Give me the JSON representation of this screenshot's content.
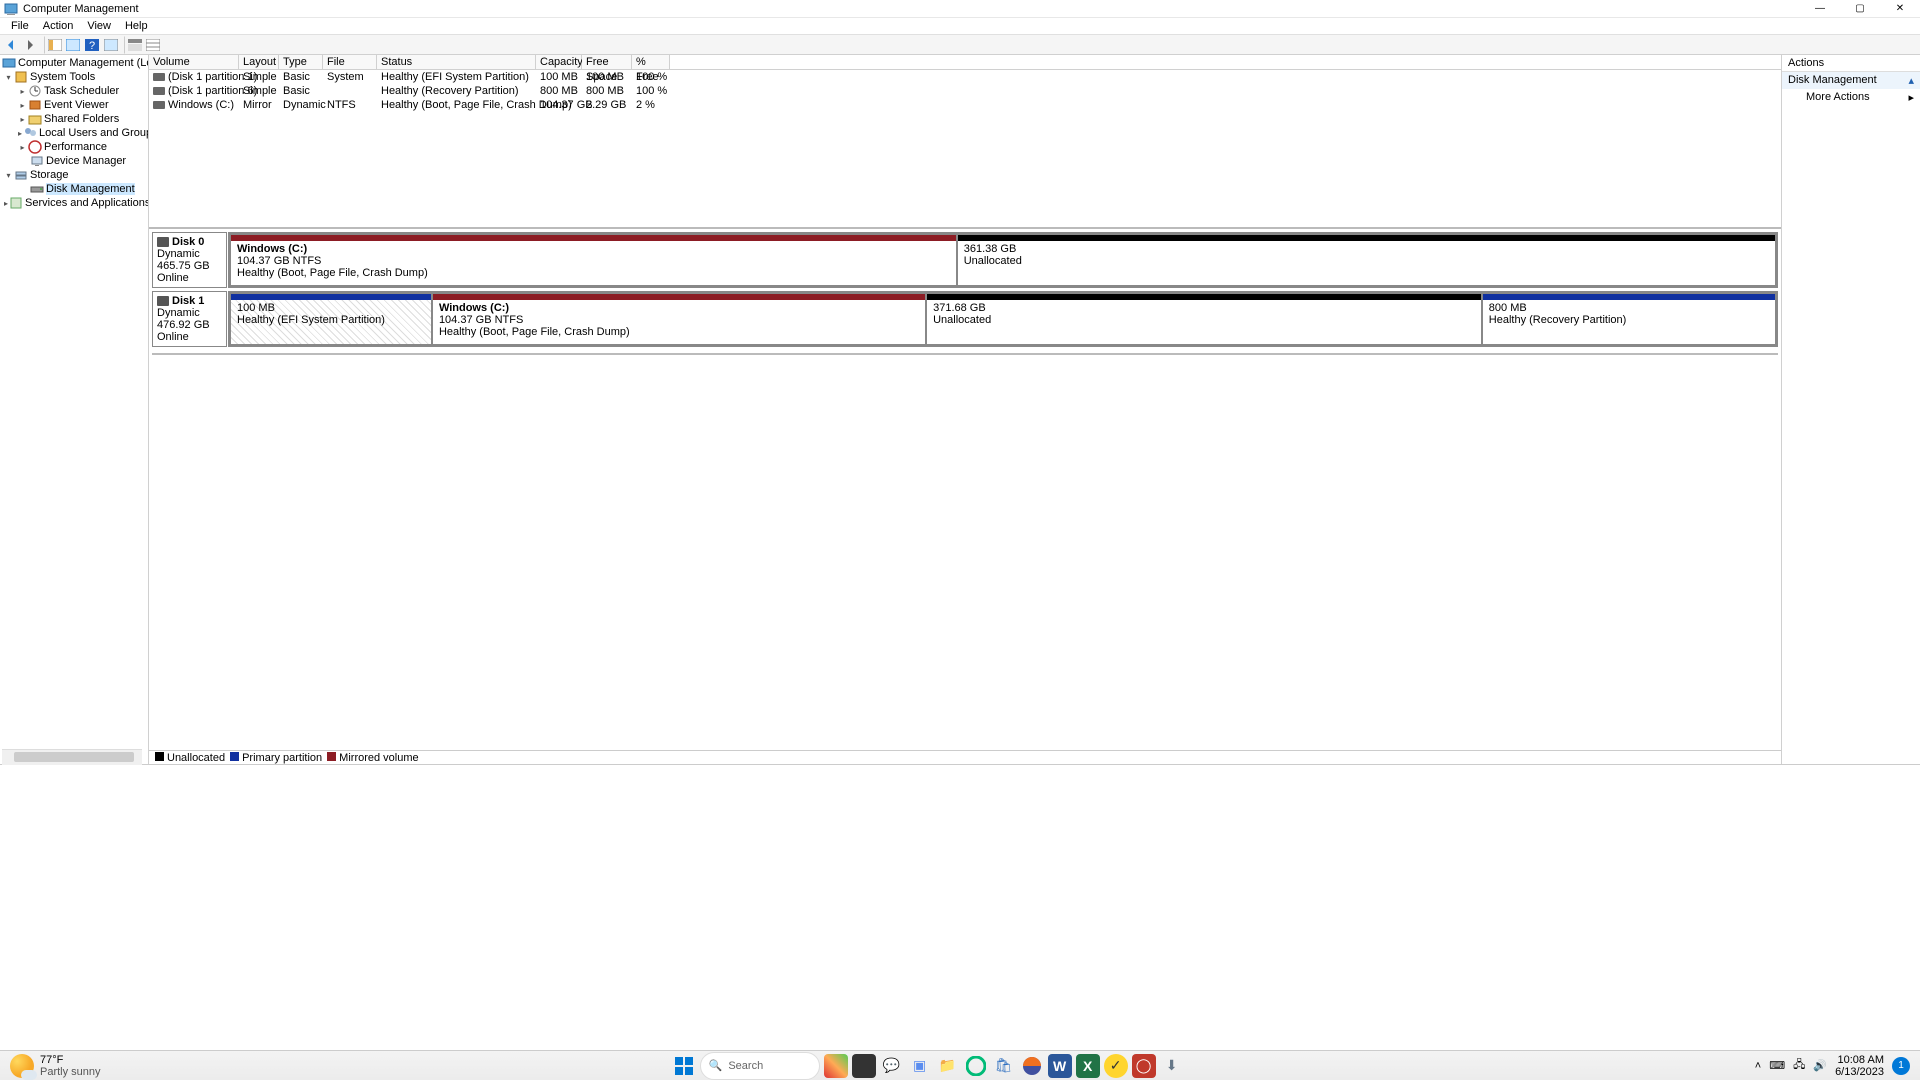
{
  "window": {
    "title": "Computer Management"
  },
  "menu": [
    "File",
    "Action",
    "View",
    "Help"
  ],
  "tree": {
    "root": "Computer Management (Local",
    "system": "System Tools",
    "ts": "Task Scheduler",
    "ev": "Event Viewer",
    "sf": "Shared Folders",
    "lug": "Local Users and Groups",
    "perf": "Performance",
    "dm": "Device Manager",
    "storage": "Storage",
    "disk": "Disk Management",
    "sa": "Services and Applications"
  },
  "cols": [
    "Volume",
    "Layout",
    "Type",
    "File System",
    "Status",
    "Capacity",
    "Free Space",
    "% Free"
  ],
  "vols": [
    {
      "v": "(Disk 1 partition 1)",
      "l": "Simple",
      "t": "Basic",
      "fs": "",
      "s": "Healthy (EFI System Partition)",
      "c": "100 MB",
      "f": "100 MB",
      "p": "100 %"
    },
    {
      "v": "(Disk 1 partition 6)",
      "l": "Simple",
      "t": "Basic",
      "fs": "",
      "s": "Healthy (Recovery Partition)",
      "c": "800 MB",
      "f": "800 MB",
      "p": "100 %"
    },
    {
      "v": "Windows (C:)",
      "l": "Mirror",
      "t": "Dynamic",
      "fs": "NTFS",
      "s": "Healthy (Boot, Page File, Crash Dump)",
      "c": "104.37 GB",
      "f": "2.29 GB",
      "p": "2 %"
    }
  ],
  "disks": [
    {
      "name": "Disk 0",
      "type": "Dynamic",
      "size": "465.75 GB",
      "status": "Online",
      "parts": [
        {
          "title": "Windows  (C:)",
          "line2": "104.37 GB NTFS",
          "line3": "Healthy (Boot, Page File, Crash Dump)",
          "color": "#8c1c24",
          "flex": 47,
          "hatch": false
        },
        {
          "title": "",
          "line2": "361.38 GB",
          "line3": "Unallocated",
          "color": "#000",
          "flex": 53,
          "hatch": false
        }
      ]
    },
    {
      "name": "Disk 1",
      "type": "Dynamic",
      "size": "476.92 GB",
      "status": "Online",
      "parts": [
        {
          "title": "",
          "line2": "100 MB",
          "line3": "Healthy (EFI System Partition)",
          "color": "#1030a0",
          "flex": 13,
          "hatch": true
        },
        {
          "title": "Windows  (C:)",
          "line2": "104.37 GB NTFS",
          "line3": "Healthy (Boot, Page File, Crash Dump)",
          "color": "#8c1c24",
          "flex": 32,
          "hatch": false
        },
        {
          "title": "",
          "line2": "371.68 GB",
          "line3": "Unallocated",
          "color": "#000",
          "flex": 36,
          "hatch": false
        },
        {
          "title": "",
          "line2": "800 MB",
          "line3": "Healthy (Recovery Partition)",
          "color": "#1030a0",
          "flex": 19,
          "hatch": false
        }
      ]
    }
  ],
  "legend": [
    {
      "color": "#000",
      "label": "Unallocated"
    },
    {
      "color": "#1030a0",
      "label": "Primary partition"
    },
    {
      "color": "#8c1c24",
      "label": "Mirrored volume"
    }
  ],
  "actions": {
    "header": "Actions",
    "section": "Disk Management",
    "more": "More Actions"
  },
  "taskbar": {
    "temp": "77°F",
    "cond": "Partly sunny",
    "search": "Search",
    "time": "10:08 AM",
    "date": "6/13/2023",
    "notif": "1"
  }
}
